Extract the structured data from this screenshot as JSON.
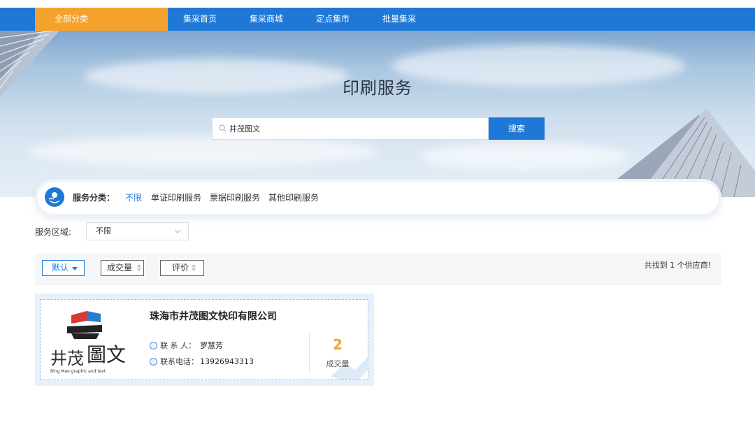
{
  "nav": {
    "all_categories": "全部分类",
    "links": [
      "集采首页",
      "集采商城",
      "定点集市",
      "批量集采"
    ]
  },
  "banner": {
    "title": "印刷服务",
    "search_value": "井茂图文",
    "search_button": "搜索"
  },
  "categories": {
    "label": "服务分类：",
    "items": [
      "不限",
      "单证印刷服务",
      "票据印刷服务",
      "其他印刷服务"
    ],
    "active_index": 0
  },
  "region": {
    "label": "服务区域:",
    "value": "不限"
  },
  "sort": {
    "default_label": "默认",
    "volume_label": "成交量",
    "rating_label": "评价",
    "found_text": "共找到 1 个供应商!"
  },
  "supplier": {
    "name": "珠海市井茂图文快印有限公司",
    "contact_label": "联 系 人：",
    "contact_value": "罗慧芳",
    "phone_label": "联系电话：",
    "phone_value": "13926943313",
    "deal_count": "2",
    "deal_label": "成交量",
    "logo_main": "井茂",
    "logo_side": "圖文",
    "logo_sub": "Bing Mao graphic and text"
  },
  "colors": {
    "primary": "#1f78d6",
    "accent": "#f5a22c"
  }
}
